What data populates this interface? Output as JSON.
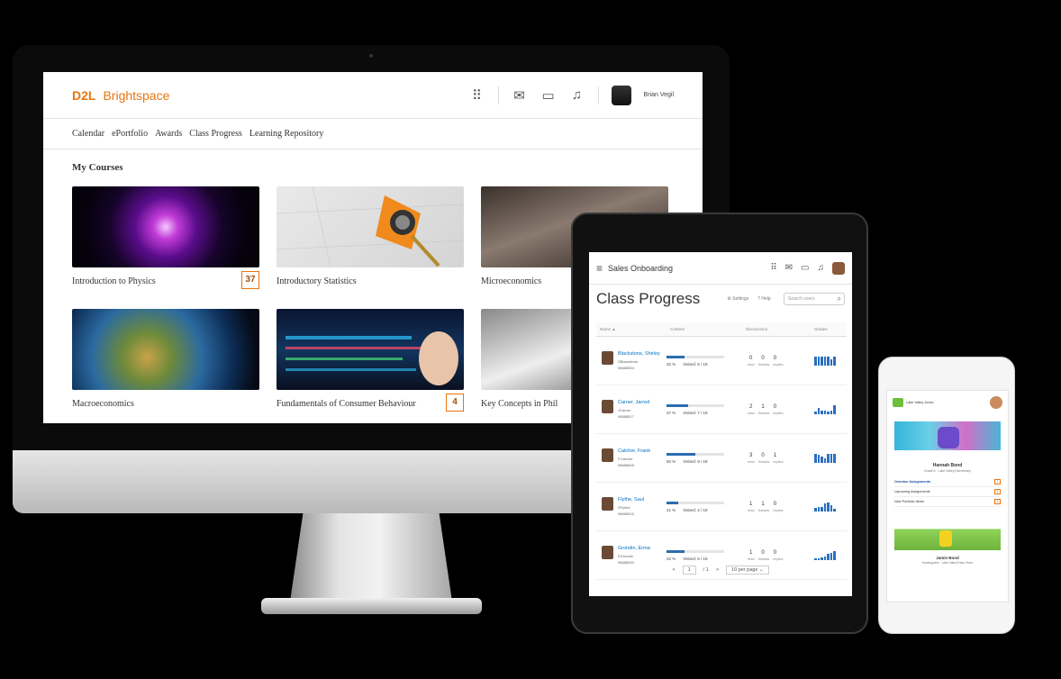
{
  "desktop": {
    "logo_d2l": "D2L",
    "logo_name": "Brightspace",
    "user_name": "Brian Vegil",
    "nav": [
      "Calendar",
      "ePortfolio",
      "Awards",
      "Class Progress",
      "Learning Repository"
    ],
    "section_title": "My Courses",
    "courses": [
      {
        "title": "Introduction to Physics",
        "badge": "37"
      },
      {
        "title": "Introductory Statistics",
        "badge": ""
      },
      {
        "title": "Microeconomics",
        "badge": ""
      },
      {
        "title": "Macroeconomics",
        "badge": ""
      },
      {
        "title": "Fundamentals of Consumer Behaviour",
        "badge": "4"
      },
      {
        "title": "Key Concepts in Phil",
        "badge": ""
      }
    ],
    "icons": [
      "grid-icon",
      "mail-icon",
      "chat-icon",
      "bell-icon"
    ]
  },
  "tablet": {
    "course_name": "Sales Onboarding",
    "page_title": "Class Progress",
    "settings_label": "Settings",
    "help_label": "Help",
    "search_placeholder": "Search users",
    "columns": [
      "Name ▲",
      "Content",
      "Discussions",
      "Grades"
    ],
    "rows": [
      {
        "name": "Blackstone, Shirley",
        "user": "SBlackstone",
        "id": "98688554",
        "percent": 32,
        "percent_label": "32 %",
        "visited": "Visited: 6 / 19",
        "read": "0",
        "threads": "0",
        "replies": "0",
        "grades": [
          8,
          8,
          8,
          8,
          8,
          5,
          8
        ]
      },
      {
        "name": "Carner, Jarred",
        "user": "JCarner",
        "id": "98688517",
        "percent": 37,
        "percent_label": "37 %",
        "visited": "Visited: 7 / 19",
        "read": "2",
        "threads": "1",
        "replies": "0",
        "grades": [
          2,
          5,
          3,
          3,
          2,
          3,
          8
        ]
      },
      {
        "name": "Catcher, Frank",
        "user": "FCatcher",
        "id": "98688658",
        "percent": 50,
        "percent_label": "50 %",
        "visited": "Visited: 9 / 18",
        "read": "3",
        "threads": "0",
        "replies": "1",
        "grades": [
          8,
          7,
          5,
          4,
          8,
          8,
          8
        ]
      },
      {
        "name": "Flythe, Saul",
        "user": "SFlythe",
        "id": "98688515",
        "percent": 21,
        "percent_label": "21 %",
        "visited": "Visited: 4 / 19",
        "read": "1",
        "threads": "1",
        "replies": "0",
        "grades": [
          3,
          4,
          4,
          7,
          8,
          5,
          2
        ]
      },
      {
        "name": "Grondin, Erma",
        "user": "EGrondin",
        "id": "98688530",
        "percent": 32,
        "percent_label": "32 %",
        "visited": "Visited: 6 / 19",
        "read": "1",
        "threads": "0",
        "replies": "0",
        "grades": [
          1,
          1,
          2,
          3,
          5,
          6,
          8
        ]
      }
    ],
    "disc_labels": [
      "read",
      "threads",
      "replies"
    ],
    "pager": {
      "prev": "<",
      "page": "1",
      "of": "/ 1",
      "next": ">",
      "per_page": "10 per page"
    }
  },
  "phone": {
    "school": "Lake Valley Junior",
    "student_name": "Hannah Bond",
    "student_sub": "Grade 6 · Lake Valley Elementary",
    "items": [
      {
        "label": "Overdue Assignments",
        "count": "1"
      },
      {
        "label": "Upcoming Assignments",
        "count": "4"
      },
      {
        "label": "New Portfolio Items",
        "count": "2"
      }
    ],
    "student2_name": "Jamie Bond",
    "student2_sub": "Kindergarten · Lake Valley Early Years"
  }
}
